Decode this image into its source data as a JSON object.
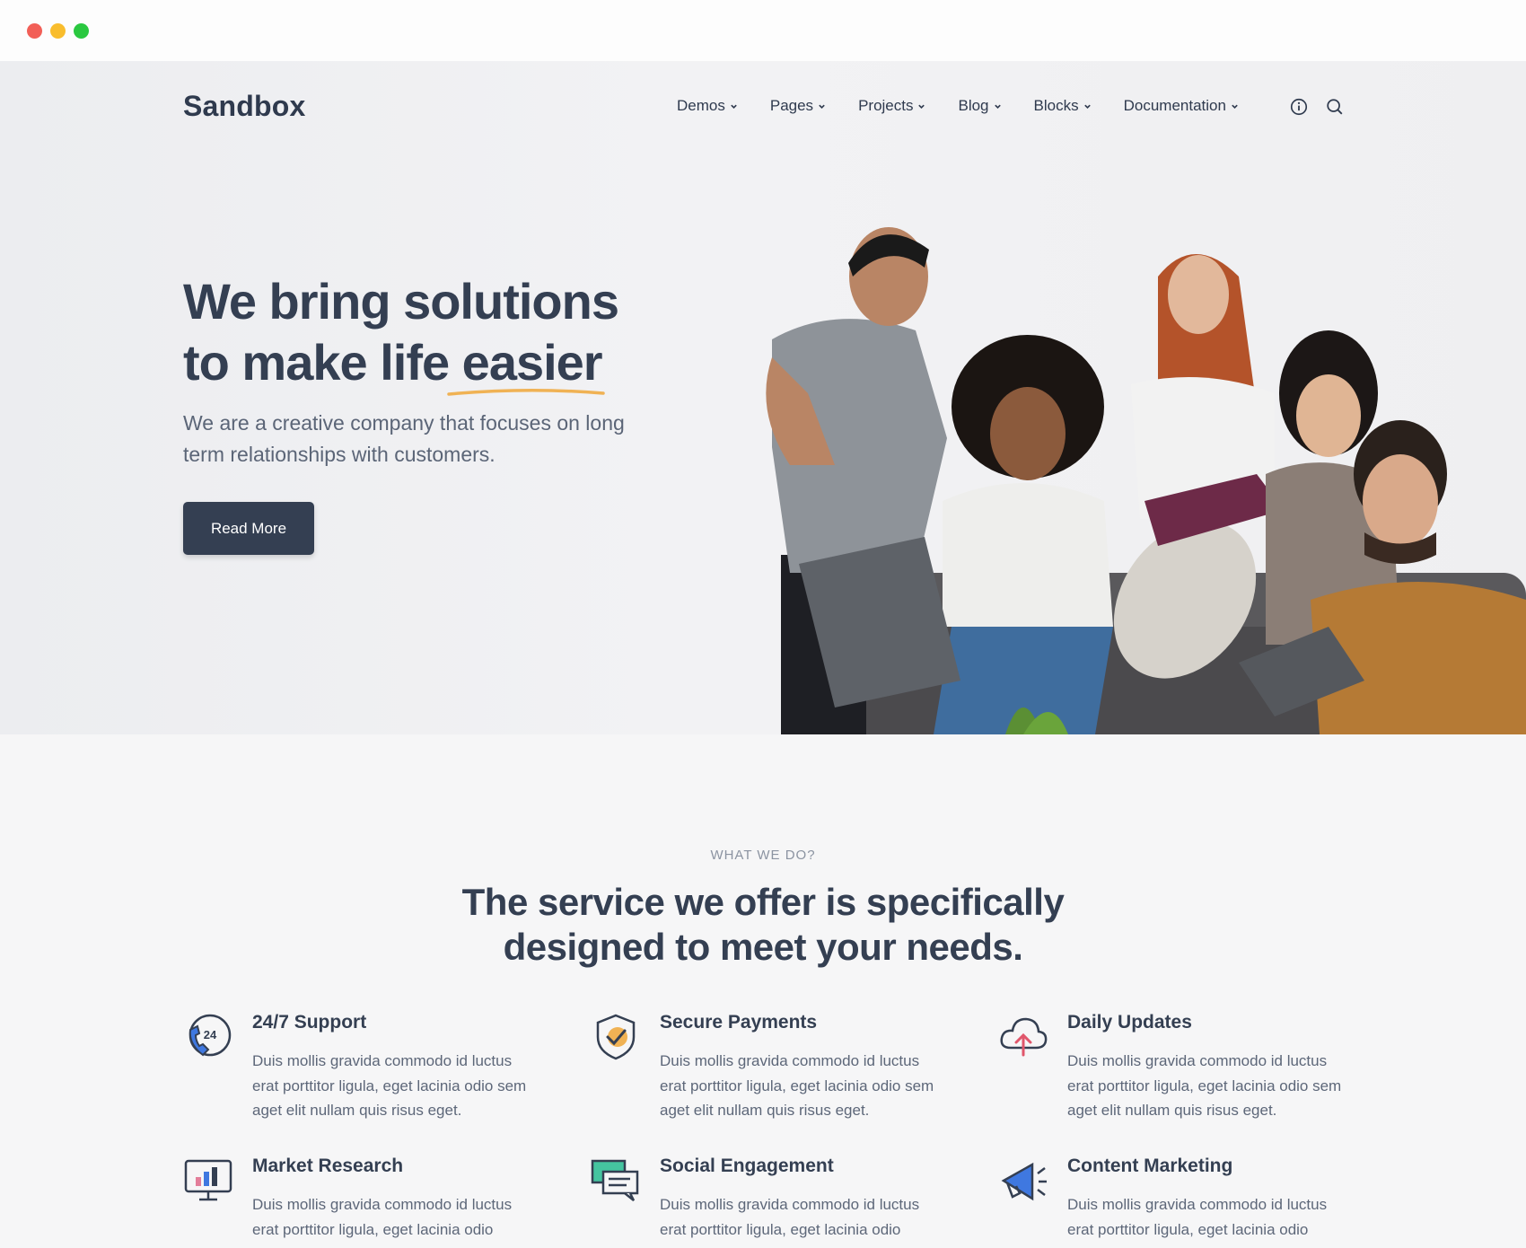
{
  "window": {
    "controls": [
      "close",
      "minimize",
      "maximize"
    ]
  },
  "header": {
    "logo": "Sandbox",
    "nav": [
      {
        "label": "Demos"
      },
      {
        "label": "Pages"
      },
      {
        "label": "Projects"
      },
      {
        "label": "Blog"
      },
      {
        "label": "Blocks"
      },
      {
        "label": "Documentation"
      }
    ],
    "icons": [
      "info-icon",
      "search-icon"
    ]
  },
  "hero": {
    "title_line1": "We bring solutions",
    "title_line2": "to make life easier",
    "subtitle": "We are a creative company that focuses on long term relationships with customers.",
    "button": "Read More"
  },
  "services": {
    "eyebrow": "WHAT WE DO?",
    "title_line1": "The service we offer is specifically",
    "title_line2": "designed to meet your needs.",
    "items": [
      {
        "title": "24/7 Support",
        "icon": "phone-24-icon",
        "text": "Duis mollis gravida commodo id luctus erat porttitor ligula, eget lacinia odio sem aget elit nullam quis risus eget."
      },
      {
        "title": "Secure Payments",
        "icon": "shield-check-icon",
        "text": "Duis mollis gravida commodo id luctus erat porttitor ligula, eget lacinia odio sem aget elit nullam quis risus eget."
      },
      {
        "title": "Daily Updates",
        "icon": "cloud-upload-icon",
        "text": "Duis mollis gravida commodo id luctus erat porttitor ligula, eget lacinia odio sem aget elit nullam quis risus eget."
      },
      {
        "title": "Market Research",
        "icon": "monitor-chart-icon",
        "text": "Duis mollis gravida commodo id luctus erat porttitor ligula, eget lacinia odio"
      },
      {
        "title": "Social Engagement",
        "icon": "chat-bubbles-icon",
        "text": "Duis mollis gravida commodo id luctus erat porttitor ligula, eget lacinia odio"
      },
      {
        "title": "Content Marketing",
        "icon": "megaphone-icon",
        "text": "Duis mollis gravida commodo id luctus erat porttitor ligula, eget lacinia odio"
      }
    ]
  },
  "colors": {
    "primary": "#343f52",
    "accent_underline": "#f0b254",
    "icon_blue": "#3f78e0",
    "icon_teal": "#45c4a0"
  }
}
